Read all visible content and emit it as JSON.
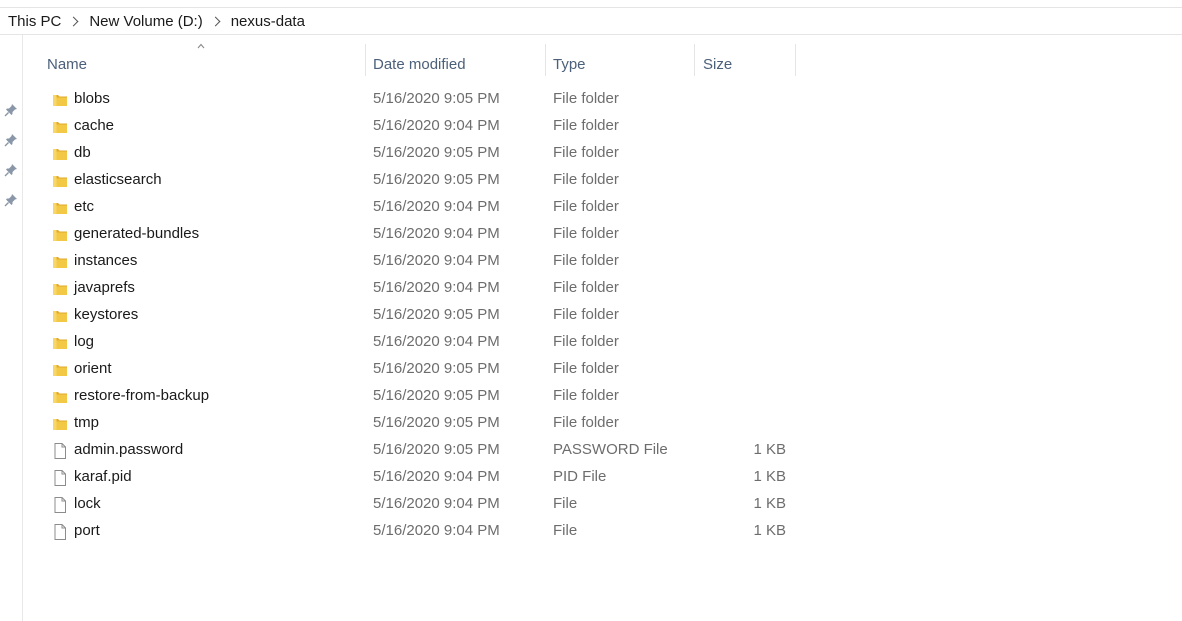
{
  "breadcrumb": [
    "This PC",
    "New Volume (D:)",
    "nexus-data"
  ],
  "columns": {
    "name": "Name",
    "date": "Date modified",
    "type": "Type",
    "size": "Size"
  },
  "icons": {
    "folder": "folder-icon",
    "file": "file-icon",
    "pin": "pin-icon",
    "sort": "sort-ascending-icon"
  },
  "colors": {
    "folder": "#f3c845",
    "folder_dark": "#e2aa2a",
    "header_text": "#4c607a",
    "secondary_text": "#6d6d6d"
  },
  "files": [
    {
      "name": "blobs",
      "date": "5/16/2020 9:05 PM",
      "type": "File folder",
      "size": "",
      "kind": "folder"
    },
    {
      "name": "cache",
      "date": "5/16/2020 9:04 PM",
      "type": "File folder",
      "size": "",
      "kind": "folder"
    },
    {
      "name": "db",
      "date": "5/16/2020 9:05 PM",
      "type": "File folder",
      "size": "",
      "kind": "folder"
    },
    {
      "name": "elasticsearch",
      "date": "5/16/2020 9:05 PM",
      "type": "File folder",
      "size": "",
      "kind": "folder"
    },
    {
      "name": "etc",
      "date": "5/16/2020 9:04 PM",
      "type": "File folder",
      "size": "",
      "kind": "folder"
    },
    {
      "name": "generated-bundles",
      "date": "5/16/2020 9:04 PM",
      "type": "File folder",
      "size": "",
      "kind": "folder"
    },
    {
      "name": "instances",
      "date": "5/16/2020 9:04 PM",
      "type": "File folder",
      "size": "",
      "kind": "folder"
    },
    {
      "name": "javaprefs",
      "date": "5/16/2020 9:04 PM",
      "type": "File folder",
      "size": "",
      "kind": "folder"
    },
    {
      "name": "keystores",
      "date": "5/16/2020 9:05 PM",
      "type": "File folder",
      "size": "",
      "kind": "folder"
    },
    {
      "name": "log",
      "date": "5/16/2020 9:04 PM",
      "type": "File folder",
      "size": "",
      "kind": "folder"
    },
    {
      "name": "orient",
      "date": "5/16/2020 9:05 PM",
      "type": "File folder",
      "size": "",
      "kind": "folder"
    },
    {
      "name": "restore-from-backup",
      "date": "5/16/2020 9:05 PM",
      "type": "File folder",
      "size": "",
      "kind": "folder"
    },
    {
      "name": "tmp",
      "date": "5/16/2020 9:05 PM",
      "type": "File folder",
      "size": "",
      "kind": "folder"
    },
    {
      "name": "admin.password",
      "date": "5/16/2020 9:05 PM",
      "type": "PASSWORD File",
      "size": "1 KB",
      "kind": "file"
    },
    {
      "name": "karaf.pid",
      "date": "5/16/2020 9:04 PM",
      "type": "PID File",
      "size": "1 KB",
      "kind": "file"
    },
    {
      "name": "lock",
      "date": "5/16/2020 9:04 PM",
      "type": "File",
      "size": "1 KB",
      "kind": "file"
    },
    {
      "name": "port",
      "date": "5/16/2020 9:04 PM",
      "type": "File",
      "size": "1 KB",
      "kind": "file"
    }
  ]
}
